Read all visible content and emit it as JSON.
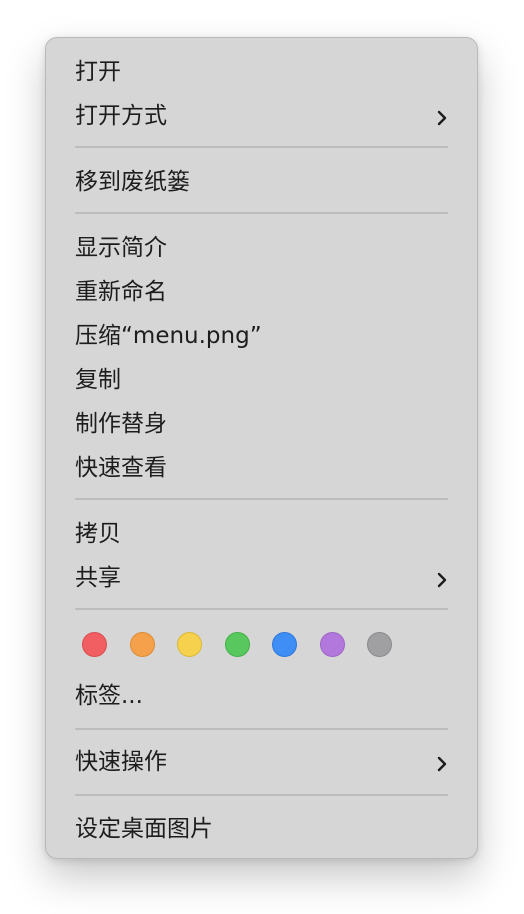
{
  "menu": {
    "items": [
      {
        "label": "打开"
      },
      {
        "label": "打开方式",
        "has_submenu": true
      },
      {
        "label": "移到废纸篓"
      },
      {
        "label": "显示简介"
      },
      {
        "label": "重新命名"
      },
      {
        "label": "压缩“menu.png”"
      },
      {
        "label": "复制"
      },
      {
        "label": "制作替身"
      },
      {
        "label": "快速查看"
      },
      {
        "label": "拷贝"
      },
      {
        "label": "共享",
        "has_submenu": true
      },
      {
        "label": "标签..."
      },
      {
        "label": "快速操作",
        "has_submenu": true
      },
      {
        "label": "设定桌面图片"
      }
    ],
    "tag_colors": [
      {
        "name": "red",
        "fill": "#f15f62",
        "stroke": "#d94b4f"
      },
      {
        "name": "orange",
        "fill": "#f5a04a",
        "stroke": "#dd8c35"
      },
      {
        "name": "yellow",
        "fill": "#f5d14d",
        "stroke": "#dbb936"
      },
      {
        "name": "green",
        "fill": "#58c75d",
        "stroke": "#43b149"
      },
      {
        "name": "blue",
        "fill": "#3f8ef5",
        "stroke": "#2f78dc"
      },
      {
        "name": "purple",
        "fill": "#b378db",
        "stroke": "#9f64c8"
      },
      {
        "name": "gray",
        "fill": "#a0a0a2",
        "stroke": "#8a8a8c"
      }
    ]
  },
  "icons": {
    "submenu": "chevron-right-icon"
  }
}
